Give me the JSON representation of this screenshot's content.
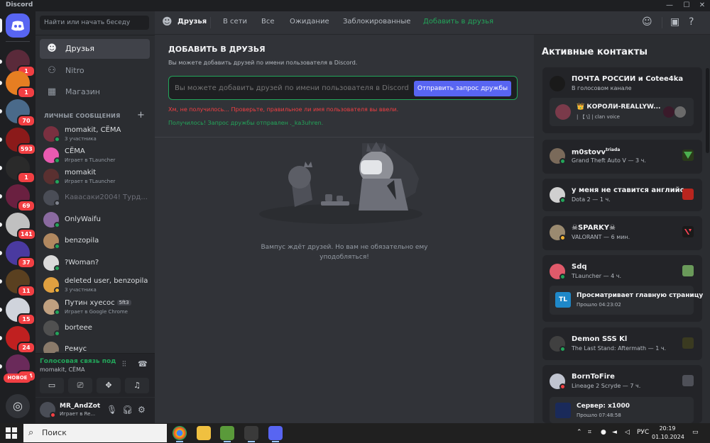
{
  "window": {
    "app_name": "Discord",
    "controls": [
      "—",
      "☐",
      "✕"
    ]
  },
  "servers": [
    {
      "badge": "",
      "color": "#5865f2"
    },
    {
      "badge": "1",
      "color": "#5a2a3a"
    },
    {
      "badge": "1",
      "color": "#e67e22"
    },
    {
      "badge": "70",
      "color": "#4a6a8a"
    },
    {
      "badge": "593",
      "color": "#8b1a1a"
    },
    {
      "badge": "1",
      "color": "#2a2a2a"
    },
    {
      "badge": "69",
      "color": "#6a2040"
    },
    {
      "badge": "141",
      "color": "#c0c0c0"
    },
    {
      "badge": "37",
      "color": "#4a3aa0"
    },
    {
      "badge": "11",
      "color": "#5a4020"
    },
    {
      "badge": "15",
      "color": "#d0d4dc"
    },
    {
      "badge": "24",
      "color": "#c02020"
    },
    {
      "badge": "364",
      "color": "#6a2a5a"
    }
  ],
  "new_label": "НОВОЕ",
  "search": {
    "placeholder": "Найти или начать беседу"
  },
  "nav": {
    "friends": "Друзья",
    "nitro": "Nitro",
    "shop": "Магазин"
  },
  "dm_header": "ЛИЧНЫЕ СООБЩЕНИЯ",
  "dms": [
    {
      "name": "momakit, CЁМА",
      "sub": "3 участника",
      "status": "#23a55a",
      "color": "#7a3040"
    },
    {
      "name": "CЁМА",
      "sub": "Играет в TLauncher",
      "status": "#23a55a",
      "color": "#e85ab0"
    },
    {
      "name": "momakit",
      "sub": "Играет в TLauncher",
      "status": "#23a55a",
      "color": "#5a3030"
    },
    {
      "name": "Кавасаки2004! Турд...",
      "sub": "",
      "status": "#80848e",
      "color": "#4a4d56"
    },
    {
      "name": "OnlyWaifu",
      "sub": "",
      "status": "#23a55a",
      "color": "#8a6aa0"
    },
    {
      "name": "benzopila",
      "sub": "",
      "status": "#23a55a",
      "color": "#b08860"
    },
    {
      "name": "?Woman?",
      "sub": "",
      "status": "#23a55a",
      "color": "#dadada"
    },
    {
      "name": "deleted user, benzopila",
      "sub": "3 участника",
      "status": "#f0b232",
      "color": "#e0a040"
    },
    {
      "name": "Путин хуесос",
      "tag": "5ft3",
      "sub": "Играет в Google Chrome",
      "status": "#23a55a",
      "color": "#c0a080"
    },
    {
      "name": "borteee",
      "sub": "",
      "status": "#23a55a",
      "color": "#505050"
    },
    {
      "name": "Ремус",
      "sub": "",
      "status": "#23a55a",
      "color": "#8a7a6a"
    }
  ],
  "voice": {
    "title": "Голосовая связь под",
    "sub": "momakit, CЁМА"
  },
  "user": {
    "name": "MR_AndZot",
    "sub": "Играет в Re..."
  },
  "topbar": {
    "friends": "Друзья",
    "online": "В сети",
    "all": "Все",
    "pending": "Ожидание",
    "blocked": "Заблокированные",
    "add_friend": "Добавить в друзья"
  },
  "add_friend": {
    "title": "ДОБАВИТЬ В ДРУЗЬЯ",
    "desc": "Вы можете добавить друзей по имени пользователя в Discord.",
    "placeholder": "Вы можете добавить друзей по имени пользователя в Discord",
    "button": "Отправить запрос дружбы",
    "error": "Хм, не получилось... Проверьте, правильное ли имя пользователя вы ввели.",
    "success": "Получилось! Запрос дружбы отправлен ._ka3uhren.",
    "empty": "Вампус ждёт друзей. Но вам не обязательно ему уподобляться!"
  },
  "active": {
    "title": "Активные контакты",
    "cards": [
      {
        "name": "ПОЧТА РОССИИ и Cotee4ka",
        "sub": "В голосовом канале",
        "inner_name": "👑 КОРОЛИ-REALLYW...",
        "inner_sub": "| 【 \\] | clan voice"
      },
      {
        "name": "m0stovv",
        "sup": "triada",
        "sub": "Grand Theft Auto V — 3 ч."
      },
      {
        "name": "у меня не ставится английс...",
        "sub": "Dota 2 — 1 ч."
      },
      {
        "name": "☠SPARKY☠",
        "sub": "VALORANT — 6 мин."
      },
      {
        "name": "Sdq",
        "sub": "TLauncher — 4 ч.",
        "inner_icon": "TL",
        "inner_name": "Просматривает главную страницу",
        "inner_sub": "Прошло 04:23:02"
      },
      {
        "name": "Demon SSS Kl",
        "sub": "The Last Stand: Aftermath — 1 ч."
      },
      {
        "name": "BornToFire",
        "sub": "Lineage 2 Scryde — 7 ч.",
        "inner_name": "Сервер: x1000",
        "inner_sub": "Прошло 07:48:58"
      }
    ]
  },
  "taskbar": {
    "search": "Поиск",
    "lang": "РУС",
    "time": "20:19",
    "date": "01.10.2024"
  }
}
